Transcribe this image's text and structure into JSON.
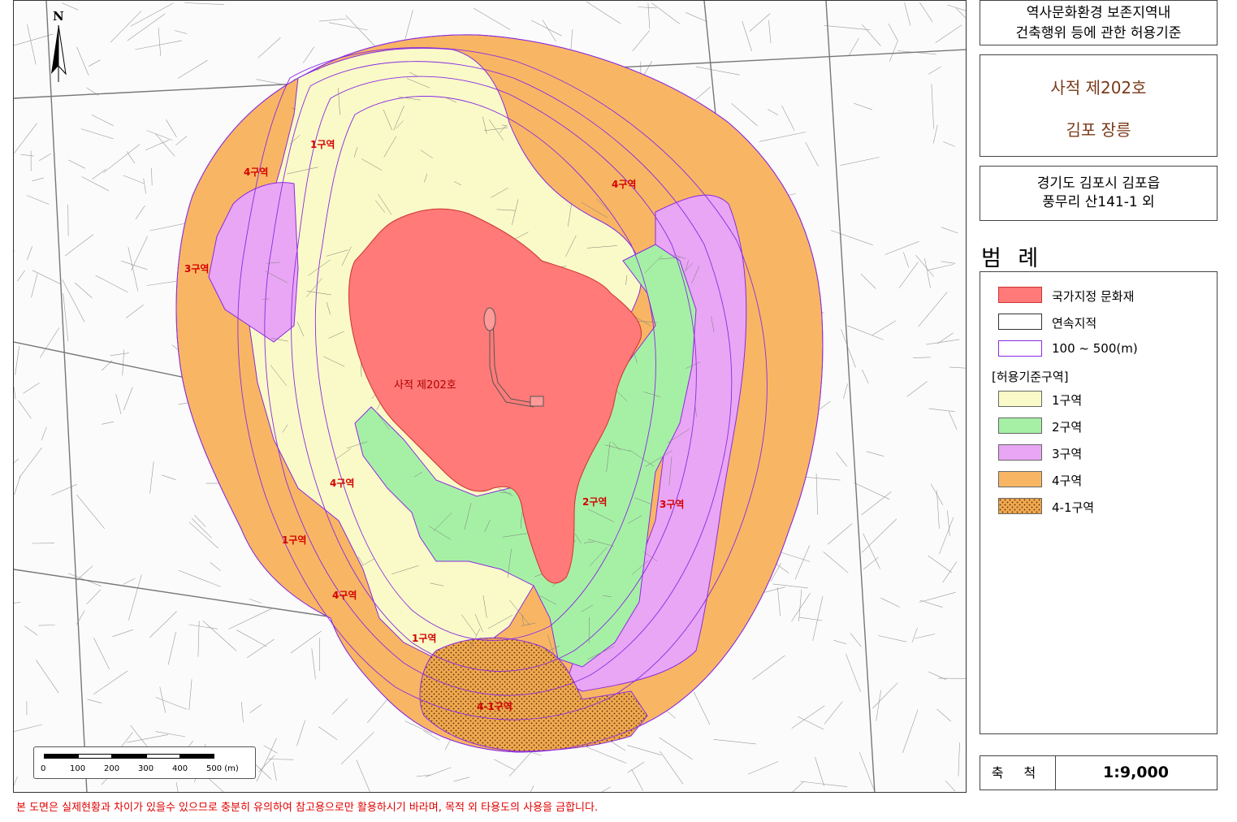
{
  "map": {
    "north_letter": "N",
    "main_label": "사적 제202호",
    "zone_labels": {
      "z1_top": "1구역",
      "z1_left": "1구역",
      "z1_bottom": "1구역",
      "z2": "2구역",
      "z3_left": "3구역",
      "z3_right": "3구역",
      "z4_top_left": "4구역",
      "z4_top_right": "4구역",
      "z4_mid_left": "4구역",
      "z4_bottom_left": "4구역",
      "z41": "4-1구역"
    },
    "colors": {
      "heritage": "#ff7a78",
      "zone1": "#fafac8",
      "zone2": "#a6f0a6",
      "zone3": "#e9a6f4",
      "zone4": "#f8b664",
      "zone41": "#f0a850",
      "boundary": "#8a2be2"
    },
    "scalebar": {
      "ticks": [
        "0",
        "100",
        "200",
        "300",
        "400",
        "500 (m)"
      ]
    },
    "disclaimer": "본 도면은 실제현황과 차이가 있을수 있으므로 충분히 유의하여 참고용으로만 활용하시기 바라며, 목적 외 타용도의 사용을 금합니다."
  },
  "panel": {
    "title_line1": "역사문화환경 보존지역내",
    "title_line2": "건축행위 등에 관한 허용기준",
    "site_line1": "사적 제202호",
    "site_line2": "김포 장릉",
    "location_line1": "경기도 김포시 김포읍",
    "location_line2": "풍무리 산141-1 외",
    "legend_title": "범 례",
    "legend": {
      "heritage": "국가지정 문화재",
      "parcel": "연속지적",
      "buffer": "100 ~ 500(m)",
      "group": "[허용기준구역]",
      "zone1": "1구역",
      "zone2": "2구역",
      "zone3": "3구역",
      "zone4": "4구역",
      "zone41": "4-1구역"
    },
    "scale_label": "축 척",
    "scale_value": "1:9,000"
  }
}
